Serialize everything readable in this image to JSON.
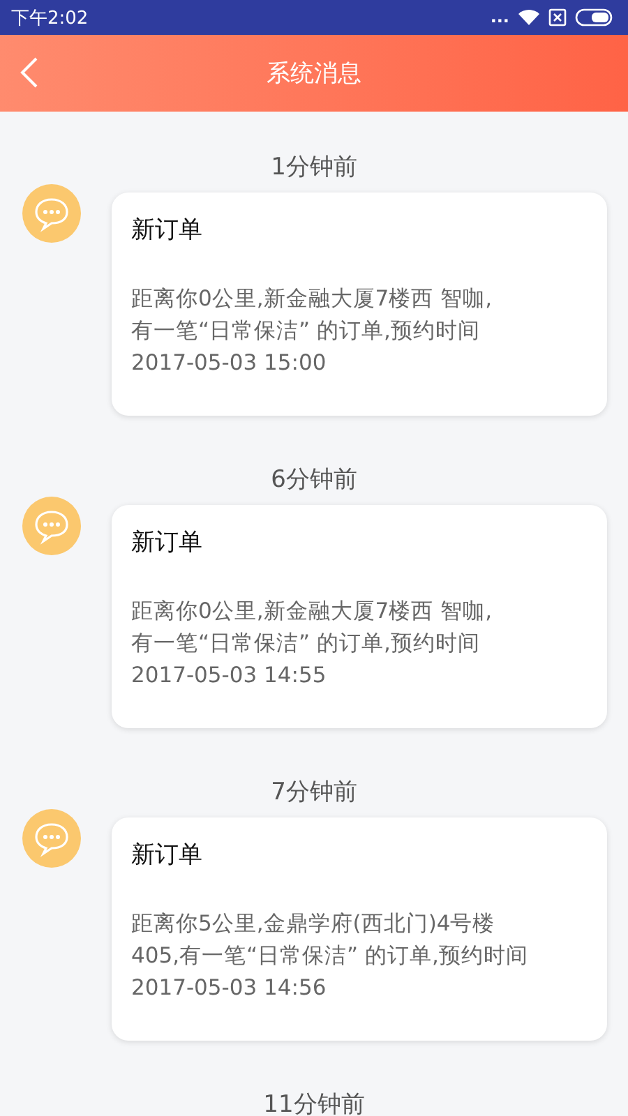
{
  "status_bar": {
    "time": "下午2:02",
    "dots": "..."
  },
  "header": {
    "title": "系统消息"
  },
  "messages": [
    {
      "time": "1分钟前",
      "title": "新订单",
      "body": "距离你0公里,新金融大厦7楼西 智咖,\n有一笔“日常保洁” 的订单,预约时间\n2017-05-03 15:00"
    },
    {
      "time": "6分钟前",
      "title": "新订单",
      "body": "距离你0公里,新金融大厦7楼西 智咖,\n有一笔“日常保洁” 的订单,预约时间\n2017-05-03 14:55"
    },
    {
      "time": "7分钟前",
      "title": "新订单",
      "body": "距离你5公里,金鼎学府(西北门)4号楼\n405,有一笔“日常保洁” 的订单,预约时间\n2017-05-03 14:56"
    }
  ],
  "next_time": "11分钟前"
}
